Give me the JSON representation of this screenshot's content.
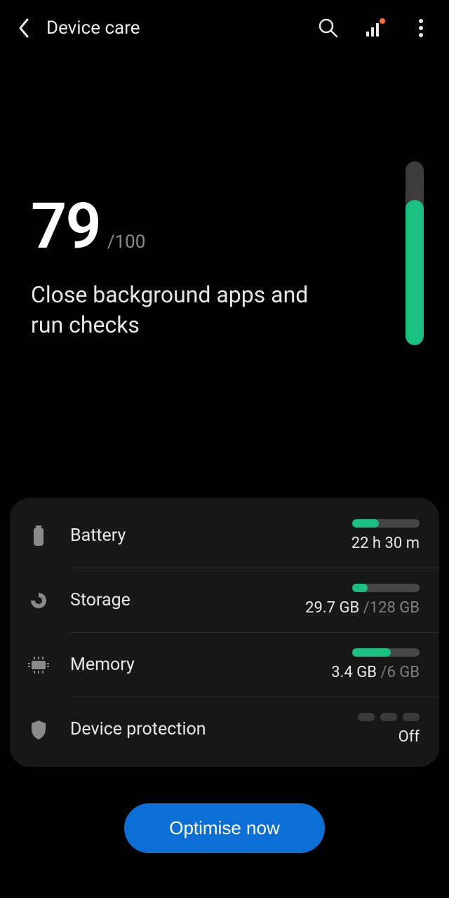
{
  "header": {
    "title": "Device care"
  },
  "score": {
    "value": "79",
    "max": "/100",
    "advice": "Close background apps and run checks",
    "fill_pct": 79
  },
  "rows": {
    "battery": {
      "label": "Battery",
      "value": "22 h 30 m",
      "fill_pct": 40
    },
    "storage": {
      "label": "Storage",
      "used": "29.7 GB ",
      "total": "/128 GB",
      "fill_pct": 23
    },
    "memory": {
      "label": "Memory",
      "used": "3.4 GB ",
      "total": "/6 GB",
      "fill_pct": 57
    },
    "security": {
      "label": "Device protection",
      "status": "Off"
    }
  },
  "cta": {
    "label": "Optimise now"
  }
}
